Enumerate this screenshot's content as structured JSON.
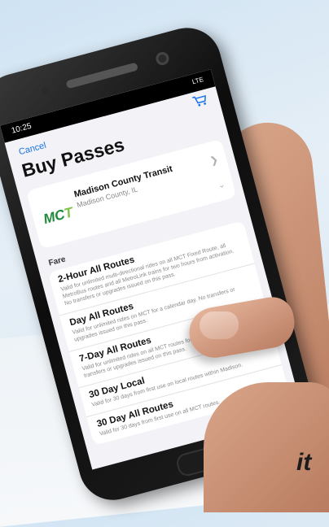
{
  "status_bar": {
    "time": "10:25",
    "network": "LTE"
  },
  "nav": {
    "cancel_label": "Cancel",
    "cart_icon": "cart-icon"
  },
  "page_title": "Buy Passes",
  "agency": {
    "logo_text_main": "MC",
    "logo_text_accent": "T",
    "name": "Madison County Transit",
    "region": "Madison County, IL"
  },
  "section_label": "Fare",
  "fares": [
    {
      "name": "2-Hour All Routes",
      "desc": "Valid for unlimited multi-directional rides on all MCT Fixed Route, all MetroBus routes and all MetroLink trains for two hours from activation. No transfers or upgrades issued on this pass."
    },
    {
      "name": "Day All Routes",
      "desc": "Valid for unlimited rides on MCT for a calendar day. No transfers or upgrades issued on this pass."
    },
    {
      "name": "7-Day All Routes",
      "desc": "Valid for unlimited rides on all MCT routes for 7 Days from first use. No transfers or upgrades issued on this pass."
    },
    {
      "name": "30 Day Local",
      "desc": "Valid for 30 days from first use on local routes within Madison."
    },
    {
      "name": "30 Day All Routes",
      "desc": "Valid for 30 days from first use on all MCT routes."
    }
  ],
  "tagline": "it"
}
